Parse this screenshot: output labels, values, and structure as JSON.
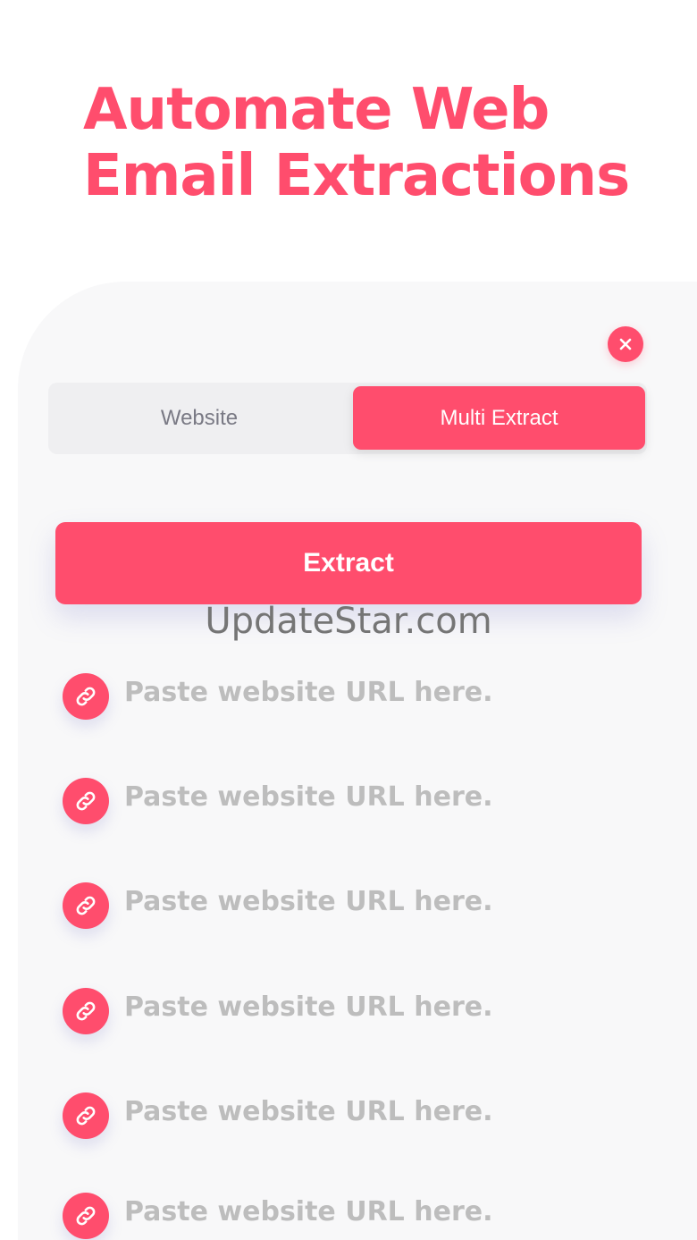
{
  "headline": {
    "line1": "Automate Web",
    "line2": "Email Extractions"
  },
  "close_button": {
    "icon": "close-icon"
  },
  "mode_toggle": {
    "options": [
      {
        "label": "Website",
        "selected": false
      },
      {
        "label": "Multi Extract",
        "selected": true
      }
    ]
  },
  "extract_button": {
    "label": "Extract"
  },
  "watermark": "UpdateStar.com",
  "url_fields": [
    {
      "placeholder": "Paste website URL here.",
      "value": "",
      "icon": "link-icon"
    },
    {
      "placeholder": "Paste website URL here.",
      "value": "",
      "icon": "link-icon"
    },
    {
      "placeholder": "Paste website URL here.",
      "value": "",
      "icon": "link-icon"
    },
    {
      "placeholder": "Paste website URL here.",
      "value": "",
      "icon": "link-icon"
    },
    {
      "placeholder": "Paste website URL here.",
      "value": "",
      "icon": "link-icon"
    },
    {
      "placeholder": "Paste website URL here.",
      "value": "",
      "icon": "link-icon"
    }
  ],
  "colors": {
    "accent": "#ff4d6d",
    "panel_background": "#f8f8f9",
    "placeholder_text": "#bdbdbd",
    "unselected_tab_text": "#7a7a85"
  }
}
